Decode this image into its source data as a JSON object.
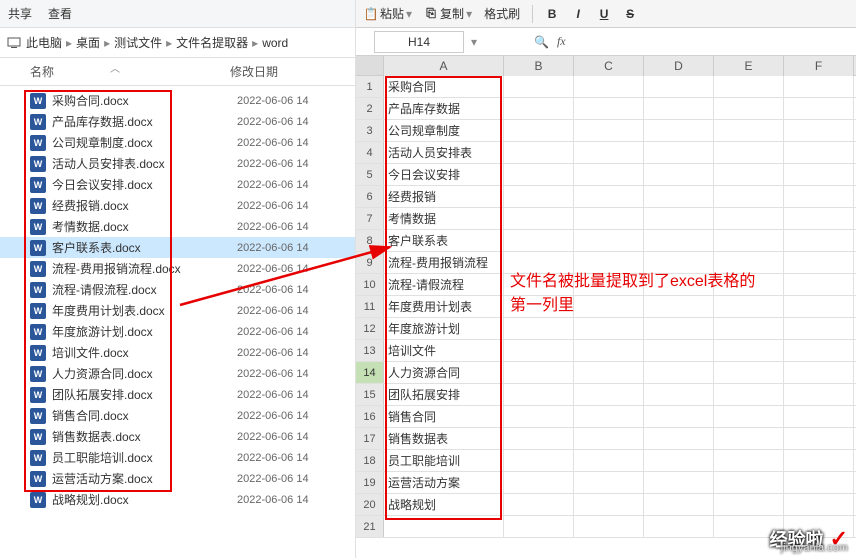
{
  "explorer": {
    "toolbar": {
      "share": "共享",
      "view": "查看"
    },
    "breadcrumb": [
      "此电脑",
      "桌面",
      "测试文件",
      "文件名提取器",
      "word"
    ],
    "columns": {
      "name": "名称",
      "date": "修改日期"
    },
    "bullet": "▸",
    "files": [
      {
        "name": "采购合同.docx",
        "date": "2022-06-06 14"
      },
      {
        "name": "产品库存数据.docx",
        "date": "2022-06-06 14"
      },
      {
        "name": "公司规章制度.docx",
        "date": "2022-06-06 14"
      },
      {
        "name": "活动人员安排表.docx",
        "date": "2022-06-06 14"
      },
      {
        "name": "今日会议安排.docx",
        "date": "2022-06-06 14"
      },
      {
        "name": "经费报销.docx",
        "date": "2022-06-06 14"
      },
      {
        "name": "考情数据.docx",
        "date": "2022-06-06 14"
      },
      {
        "name": "客户联系表.docx",
        "date": "2022-06-06 14"
      },
      {
        "name": "流程-费用报销流程.docx",
        "date": "2022-06-06 14"
      },
      {
        "name": "流程-请假流程.docx",
        "date": "2022-06-06 14"
      },
      {
        "name": "年度费用计划表.docx",
        "date": "2022-06-06 14"
      },
      {
        "name": "年度旅游计划.docx",
        "date": "2022-06-06 14"
      },
      {
        "name": "培训文件.docx",
        "date": "2022-06-06 14"
      },
      {
        "name": "人力资源合同.docx",
        "date": "2022-06-06 14"
      },
      {
        "name": "团队拓展安排.docx",
        "date": "2022-06-06 14"
      },
      {
        "name": "销售合同.docx",
        "date": "2022-06-06 14"
      },
      {
        "name": "销售数据表.docx",
        "date": "2022-06-06 14"
      },
      {
        "name": "员工职能培训.docx",
        "date": "2022-06-06 14"
      },
      {
        "name": "运营活动方案.docx",
        "date": "2022-06-06 14"
      },
      {
        "name": "战略规划.docx",
        "date": "2022-06-06 14"
      }
    ],
    "selected_index": 7,
    "word_icon_label": "W"
  },
  "spreadsheet": {
    "toolbar": {
      "paste": "粘贴",
      "copy": "复制",
      "format": "格式刷"
    },
    "format_buttons": {
      "bold": "B",
      "italic": "I",
      "underline": "U",
      "strike": "S"
    },
    "name_box": "H14",
    "fx_label": "fx",
    "columns": [
      "A",
      "B",
      "C",
      "D",
      "E",
      "F"
    ],
    "cells_a": [
      "采购合同",
      "产品库存数据",
      "公司规章制度",
      "活动人员安排表",
      "今日会议安排",
      "经费报销",
      "考情数据",
      "客户联系表",
      "流程-费用报销流程",
      "流程-请假流程",
      "年度费用计划表",
      "年度旅游计划",
      "培训文件",
      "人力资源合同",
      "团队拓展安排",
      "销售合同",
      "销售数据表",
      "员工职能培训",
      "运营活动方案",
      "战略规划"
    ],
    "highlight_row": 14,
    "total_rows": 21
  },
  "annotation": {
    "line1": "文件名被批量提取到了excel表格的",
    "line2": "第一列里"
  },
  "watermark": {
    "text": "经验啦",
    "url": "jingyanla.com"
  }
}
